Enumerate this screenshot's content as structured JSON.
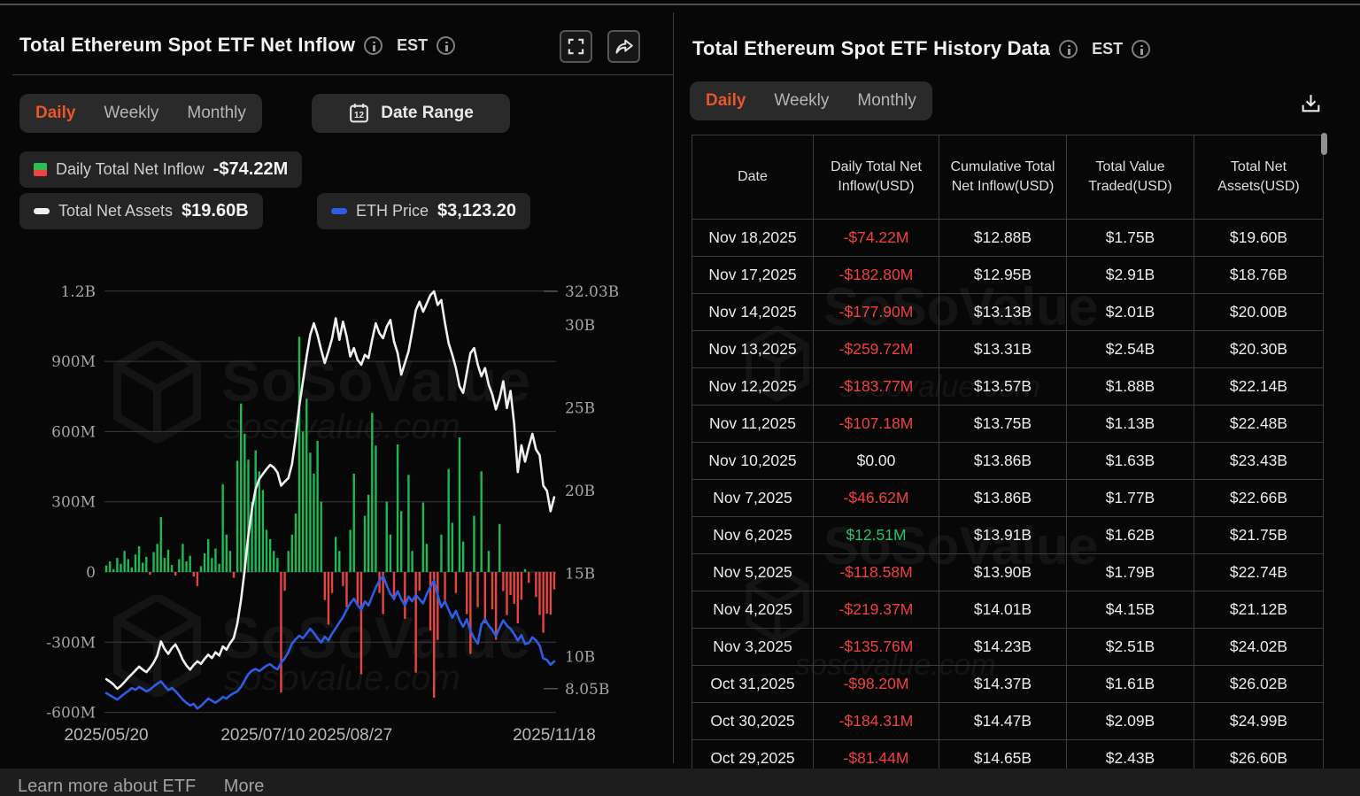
{
  "page": {
    "bottom_bar": {
      "text_left": "Learn more about ETF",
      "more_label": "More"
    }
  },
  "icons": {
    "calendar_text": "12"
  },
  "watermark": {
    "brand": "SoSoValue",
    "domain": "sosovalue.com"
  },
  "colors": {
    "accent_orange": "#e8562c",
    "bar_green": "#1eb955",
    "bar_red": "#e6453f",
    "table_green": "#2bc169",
    "table_red": "#f04141",
    "assets_line_white": "#f0f0f0",
    "eth_line_blue": "#2d5ce6"
  },
  "left_panel": {
    "title": "Total Ethereum Spot ETF Net Inflow",
    "est_label": "EST",
    "tabs": {
      "daily": "Daily",
      "weekly": "Weekly",
      "monthly": "Monthly"
    },
    "date_range_label": "Date Range",
    "legend": [
      {
        "label": "Daily Total Net Inflow",
        "value": "-$74.22M"
      },
      {
        "label": "Total Net Assets",
        "value": "$19.60B"
      },
      {
        "label": "ETH Price",
        "value": "$3,123.20"
      }
    ]
  },
  "right_panel": {
    "title": "Total Ethereum Spot ETF History Data",
    "est_label": "EST",
    "tabs": {
      "daily": "Daily",
      "weekly": "Weekly",
      "monthly": "Monthly"
    },
    "table": {
      "headers": [
        "Date",
        "Daily Total Net Inflow(USD)",
        "Cumulative Total Net Inflow(USD)",
        "Total Value Traded(USD)",
        "Total Net Assets(USD)"
      ],
      "rows": [
        [
          "Nov 18,2025",
          "-$74.22M",
          "$12.88B",
          "$1.75B",
          "$19.60B"
        ],
        [
          "Nov 17,2025",
          "-$182.80M",
          "$12.95B",
          "$2.91B",
          "$18.76B"
        ],
        [
          "Nov 14,2025",
          "-$177.90M",
          "$13.13B",
          "$2.01B",
          "$20.00B"
        ],
        [
          "Nov 13,2025",
          "-$259.72M",
          "$13.31B",
          "$2.54B",
          "$20.30B"
        ],
        [
          "Nov 12,2025",
          "-$183.77M",
          "$13.57B",
          "$1.88B",
          "$22.14B"
        ],
        [
          "Nov 11,2025",
          "-$107.18M",
          "$13.75B",
          "$1.13B",
          "$22.48B"
        ],
        [
          "Nov 10,2025",
          "$0.00",
          "$13.86B",
          "$1.63B",
          "$23.43B"
        ],
        [
          "Nov 7,2025",
          "-$46.62M",
          "$13.86B",
          "$1.77B",
          "$22.66B"
        ],
        [
          "Nov 6,2025",
          "$12.51M",
          "$13.91B",
          "$1.62B",
          "$21.75B"
        ],
        [
          "Nov 5,2025",
          "-$118.58M",
          "$13.90B",
          "$1.79B",
          "$22.74B"
        ],
        [
          "Nov 4,2025",
          "-$219.37M",
          "$14.01B",
          "$4.15B",
          "$21.12B"
        ],
        [
          "Nov 3,2025",
          "-$135.76M",
          "$14.23B",
          "$2.51B",
          "$24.02B"
        ],
        [
          "Oct 31,2025",
          "-$98.20M",
          "$14.37B",
          "$1.61B",
          "$26.02B"
        ],
        [
          "Oct 30,2025",
          "-$184.31M",
          "$14.47B",
          "$2.09B",
          "$24.99B"
        ],
        [
          "Oct 29,2025",
          "-$81.44M",
          "$14.65B",
          "$2.43B",
          "$26.60B"
        ]
      ]
    }
  },
  "chart_data": {
    "type": "bar+line combo",
    "title": "Total Ethereum Spot ETF Net Inflow",
    "x_range": [
      "2025/05/20",
      "2025/11/18"
    ],
    "x_tick_labels": [
      "2025/05/20",
      "2025/07/10",
      "2025/08/27",
      "2025/11/18"
    ],
    "x_tick_indices": [
      0,
      43,
      67,
      123
    ],
    "left_axis": {
      "unit": "USD",
      "min": -600,
      "max": 1200,
      "tick_labels": [
        "1.2B",
        "900M",
        "600M",
        "300M",
        "0",
        "-300M",
        "-600M"
      ],
      "tick_values": [
        1200,
        900,
        600,
        300,
        0,
        -300,
        -600
      ]
    },
    "right_axis": {
      "unit": "USD_B",
      "min": 8.05,
      "max": 32.03,
      "ticks": [
        {
          "label": "32.03B",
          "value": 32.03
        },
        {
          "label": "30B",
          "value": 30
        },
        {
          "label": "25B",
          "value": 25
        },
        {
          "label": "20B",
          "value": 20
        },
        {
          "label": "15B",
          "value": 15
        },
        {
          "label": "10B",
          "value": 10
        },
        {
          "label": "8.05B",
          "value": 8.05
        }
      ]
    },
    "grid": true,
    "legend_position": "top-left",
    "series": [
      {
        "name": "Daily Total Net Inflow",
        "type": "bar",
        "unit": "USD millions",
        "axis": "left",
        "latest": -74.22,
        "values": [
          28,
          45,
          12,
          60,
          35,
          90,
          55,
          20,
          75,
          110,
          40,
          65,
          -12,
          85,
          120,
          235,
          60,
          95,
          30,
          -15,
          55,
          120,
          45,
          70,
          -20,
          -60,
          25,
          80,
          140,
          60,
          100,
          35,
          375,
          160,
          90,
          -25,
          475,
          720,
          590,
          480,
          300,
          520,
          430,
          350,
          180,
          140,
          90,
          60,
          -515,
          -80,
          90,
          160,
          250,
          1005,
          600,
          740,
          510,
          420,
          560,
          300,
          -120,
          -225,
          -90,
          150,
          90,
          -60,
          -150,
          180,
          420,
          -140,
          -437,
          240,
          330,
          680,
          540,
          -90,
          -180,
          300,
          160,
          -120,
          545,
          260,
          -200,
          415,
          90,
          -430,
          -80,
          297,
          120,
          -250,
          -537,
          -290,
          160,
          -120,
          440,
          210,
          -90,
          575,
          130,
          -180,
          -350,
          240,
          -150,
          430,
          -220,
          90,
          -160,
          -290,
          205,
          -81.44,
          -184.31,
          -98.2,
          -135.76,
          -219.37,
          -118.58,
          12.51,
          -46.62,
          0,
          -107.18,
          -183.77,
          -259.72,
          -177.9,
          -182.8,
          -74.22
        ]
      },
      {
        "name": "Total Net Assets",
        "type": "line",
        "unit": "USD billions",
        "axis": "right",
        "latest": 19.6,
        "values": [
          8.62,
          8.48,
          8.3,
          8.05,
          8.22,
          8.45,
          8.7,
          8.92,
          9.15,
          9.38,
          9.2,
          9.05,
          9.3,
          9.62,
          10.05,
          10.9,
          10.45,
          10.15,
          10.5,
          10.72,
          10.3,
          9.8,
          9.45,
          9.2,
          9.48,
          9.7,
          9.55,
          9.85,
          10.1,
          9.9,
          10.25,
          10.05,
          10.6,
          10.4,
          10.8,
          11.1,
          12.0,
          13.4,
          15.2,
          17.3,
          18.9,
          20.1,
          20.7,
          21.0,
          21.3,
          21.55,
          21.4,
          21.1,
          20.3,
          20.55,
          20.75,
          21.6,
          23.2,
          25.1,
          26.6,
          28.1,
          29.4,
          30.1,
          29.4,
          28.5,
          27.7,
          28.4,
          29.2,
          30.4,
          29.1,
          30.2,
          29.3,
          28.1,
          28.6,
          27.9,
          27.6,
          28.2,
          28.0,
          29.1,
          30.1,
          29.5,
          29.2,
          29.9,
          30.3,
          29.0,
          28.3,
          27.0,
          27.7,
          28.4,
          29.6,
          30.9,
          31.4,
          30.8,
          31.3,
          31.8,
          32.03,
          31.2,
          31.5,
          30.1,
          28.9,
          28.2,
          27.4,
          26.3,
          25.9,
          27.1,
          28.3,
          28.6,
          27.6,
          26.9,
          27.4,
          26.4,
          25.8,
          24.9,
          25.6,
          26.6,
          24.99,
          26.02,
          24.02,
          21.12,
          22.74,
          21.75,
          22.66,
          23.43,
          22.48,
          22.14,
          20.3,
          20.0,
          18.76,
          19.6
        ]
      },
      {
        "name": "ETH Price",
        "type": "line",
        "unit": "USD",
        "axis": "hidden",
        "latest": 3123.2,
        "values": [
          2520,
          2480,
          2440,
          2400,
          2455,
          2510,
          2560,
          2620,
          2585,
          2640,
          2600,
          2555,
          2590,
          2650,
          2700,
          2745,
          2660,
          2580,
          2620,
          2560,
          2480,
          2400,
          2340,
          2290,
          2320,
          2230,
          2280,
          2350,
          2420,
          2380,
          2340,
          2390,
          2450,
          2420,
          2480,
          2520,
          2560,
          2640,
          2760,
          2880,
          2950,
          2980,
          2940,
          2990,
          3040,
          3070,
          3010,
          2970,
          3100,
          3180,
          3300,
          3460,
          3540,
          3610,
          3560,
          3650,
          3740,
          3660,
          3560,
          3480,
          3590,
          3520,
          3650,
          3750,
          3860,
          3960,
          4100,
          4220,
          4310,
          4190,
          4100,
          4260,
          4180,
          4350,
          4520,
          4650,
          4740,
          4560,
          4400,
          4310,
          4450,
          4300,
          4180,
          4350,
          4260,
          4380,
          4300,
          4220,
          4400,
          4530,
          4650,
          4380,
          4150,
          4260,
          4100,
          3950,
          4080,
          3900,
          3780,
          3920,
          3700,
          3560,
          3460,
          3820,
          3920,
          3800,
          3720,
          3600,
          3760,
          3900,
          3800,
          3740,
          3640,
          3520,
          3620,
          3450,
          3470,
          3580,
          3520,
          3420,
          3180,
          3150,
          3060,
          3123.2
        ]
      }
    ]
  }
}
